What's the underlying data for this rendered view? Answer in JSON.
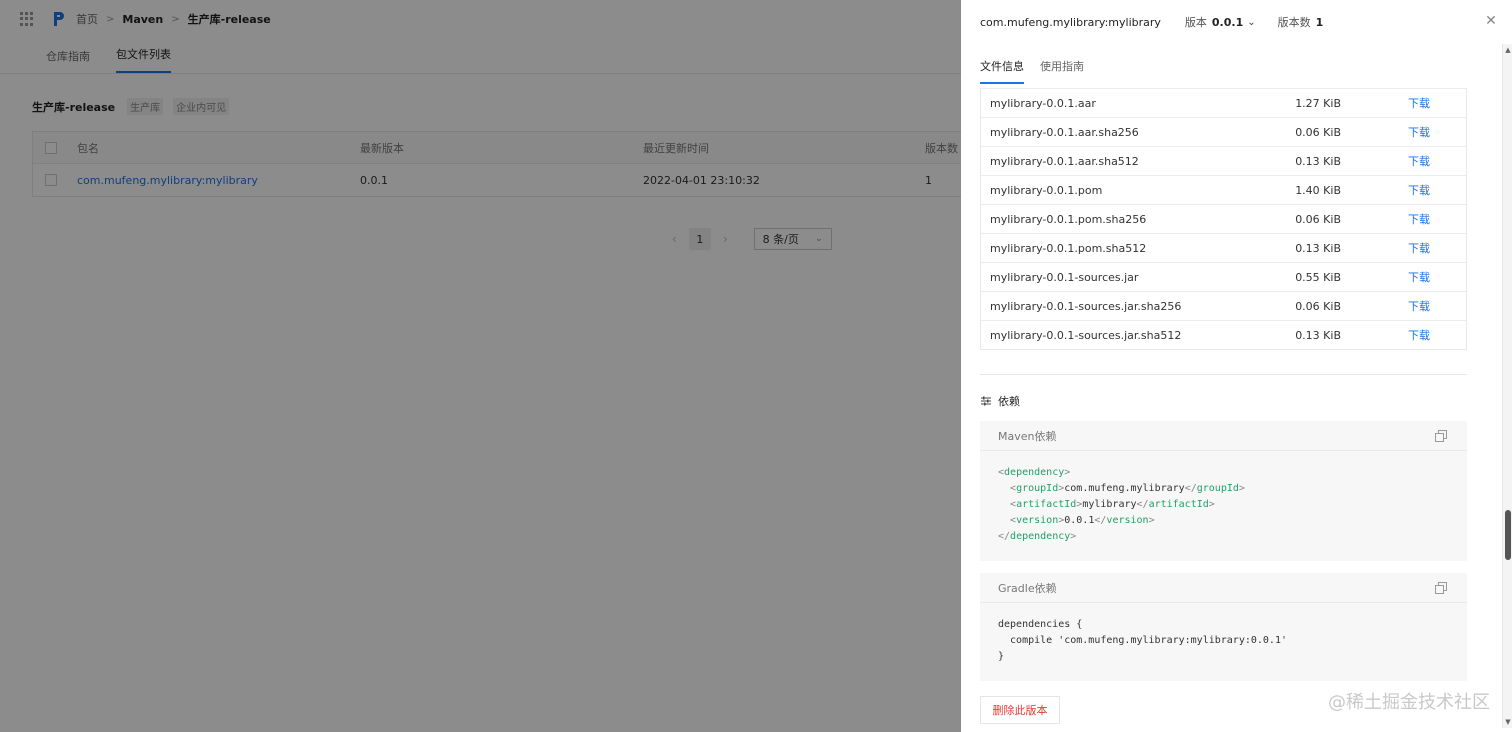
{
  "breadcrumb": {
    "home": "首页",
    "maven": "Maven",
    "repo": "生产库-release"
  },
  "subtabs": [
    {
      "label": "仓库指南",
      "active": false
    },
    {
      "label": "包文件列表",
      "active": true
    }
  ],
  "repo": {
    "name": "生产库-release",
    "tag1": "生产库",
    "tag2": "企业内可见"
  },
  "table": {
    "headers": [
      "包名",
      "最新版本",
      "最近更新时间",
      "版本数"
    ],
    "rows": [
      {
        "name": "com.mufeng.mylibrary:mylibrary",
        "version": "0.0.1",
        "updated": "2022-04-01 23:10:32",
        "count": "1"
      }
    ]
  },
  "pager": {
    "prev": "‹",
    "page": "1",
    "next": "›",
    "page_size": "8 条/页"
  },
  "drawer": {
    "title": "com.mufeng.mylibrary:mylibrary",
    "version_label": "版本",
    "version_value": "0.0.1",
    "count_label": "版本数",
    "count_value": "1",
    "close": "✕",
    "tabs": [
      {
        "label": "文件信息",
        "active": true
      },
      {
        "label": "使用指南",
        "active": false
      }
    ],
    "files": [
      {
        "name": "mylibrary-0.0.1.aar",
        "size": "1.27 KiB",
        "action": "下载"
      },
      {
        "name": "mylibrary-0.0.1.aar.sha256",
        "size": "0.06 KiB",
        "action": "下载"
      },
      {
        "name": "mylibrary-0.0.1.aar.sha512",
        "size": "0.13 KiB",
        "action": "下载"
      },
      {
        "name": "mylibrary-0.0.1.pom",
        "size": "1.40 KiB",
        "action": "下载"
      },
      {
        "name": "mylibrary-0.0.1.pom.sha256",
        "size": "0.06 KiB",
        "action": "下载"
      },
      {
        "name": "mylibrary-0.0.1.pom.sha512",
        "size": "0.13 KiB",
        "action": "下载"
      },
      {
        "name": "mylibrary-0.0.1-sources.jar",
        "size": "0.55 KiB",
        "action": "下载"
      },
      {
        "name": "mylibrary-0.0.1-sources.jar.sha256",
        "size": "0.06 KiB",
        "action": "下载"
      },
      {
        "name": "mylibrary-0.0.1-sources.jar.sha512",
        "size": "0.13 KiB",
        "action": "下载"
      }
    ],
    "dep_title": "依赖",
    "maven": {
      "title": "Maven依赖",
      "group_id": "com.mufeng.mylibrary",
      "artifact_id": "mylibrary",
      "version": "0.0.1"
    },
    "gradle": {
      "title": "Gradle依赖",
      "line1": "dependencies {",
      "line2": "  compile 'com.mufeng.mylibrary:mylibrary:0.0.1'",
      "line3": "}"
    },
    "delete_label": "删除此版本"
  },
  "watermark": "@稀土掘金技术社区",
  "colors": {
    "accent": "#1a73e8",
    "danger": "#e53935",
    "xml_tag": "#22a06b"
  }
}
